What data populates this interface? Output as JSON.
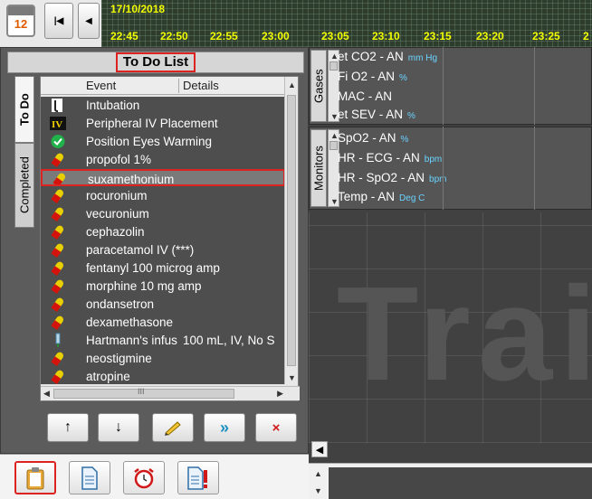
{
  "header": {
    "calendar_day": "12",
    "date": "17/10/2018",
    "times": [
      "22:45",
      "22:50",
      "22:55",
      "23:00",
      "23:05",
      "23:10",
      "23:15",
      "23:20",
      "23:25",
      "2"
    ]
  },
  "todo": {
    "title": "To Do List",
    "tabs": [
      "To Do",
      "Completed"
    ],
    "columns": [
      "Event",
      "Details"
    ],
    "items": [
      {
        "icon": "intubation-icon",
        "event": "Intubation",
        "details": ""
      },
      {
        "icon": "iv-icon",
        "event": "Peripheral IV Placement",
        "details": ""
      },
      {
        "icon": "check-icon",
        "event": "Position Eyes Warming",
        "details": ""
      },
      {
        "icon": "pill-icon",
        "event": "propofol 1%",
        "details": ""
      },
      {
        "icon": "pill-icon",
        "event": "suxamethonium",
        "details": ""
      },
      {
        "icon": "pill-icon",
        "event": "rocuronium",
        "details": ""
      },
      {
        "icon": "pill-icon",
        "event": "vecuronium",
        "details": ""
      },
      {
        "icon": "pill-icon",
        "event": "cephazolin",
        "details": ""
      },
      {
        "icon": "pill-icon",
        "event": "paracetamol IV (***)",
        "details": ""
      },
      {
        "icon": "pill-icon",
        "event": "fentanyl 100 microg amp",
        "details": ""
      },
      {
        "icon": "pill-icon",
        "event": "morphine 10 mg amp",
        "details": ""
      },
      {
        "icon": "pill-icon",
        "event": "ondansetron",
        "details": ""
      },
      {
        "icon": "pill-icon",
        "event": "dexamethasone",
        "details": ""
      },
      {
        "icon": "drip-icon",
        "event": "Hartmann's infus",
        "details": "100 mL, IV, No S"
      },
      {
        "icon": "pill-icon",
        "event": "neostigmine",
        "details": ""
      },
      {
        "icon": "pill-icon",
        "event": "atropine",
        "details": ""
      }
    ],
    "selected_index": 4,
    "hscroll_label": "III",
    "actions": [
      "move-up",
      "move-down",
      "edit",
      "forward",
      "delete"
    ]
  },
  "gases": {
    "label": "Gases",
    "rows": [
      {
        "name": "et CO2 - AN",
        "unit": "mm Hg"
      },
      {
        "name": "Fi O2 - AN",
        "unit": "%"
      },
      {
        "name": "MAC - AN",
        "unit": ""
      },
      {
        "name": "et SEV - AN",
        "unit": "%"
      }
    ]
  },
  "monitors": {
    "label": "Monitors",
    "rows": [
      {
        "name": "SpO2 - AN",
        "unit": "%"
      },
      {
        "name": "HR - ECG - AN",
        "unit": "bpm"
      },
      {
        "name": "HR - SpO2 - AN",
        "unit": "bpm"
      },
      {
        "name": "Temp - AN",
        "unit": "Deg C"
      }
    ]
  },
  "watermark": "Trai"
}
